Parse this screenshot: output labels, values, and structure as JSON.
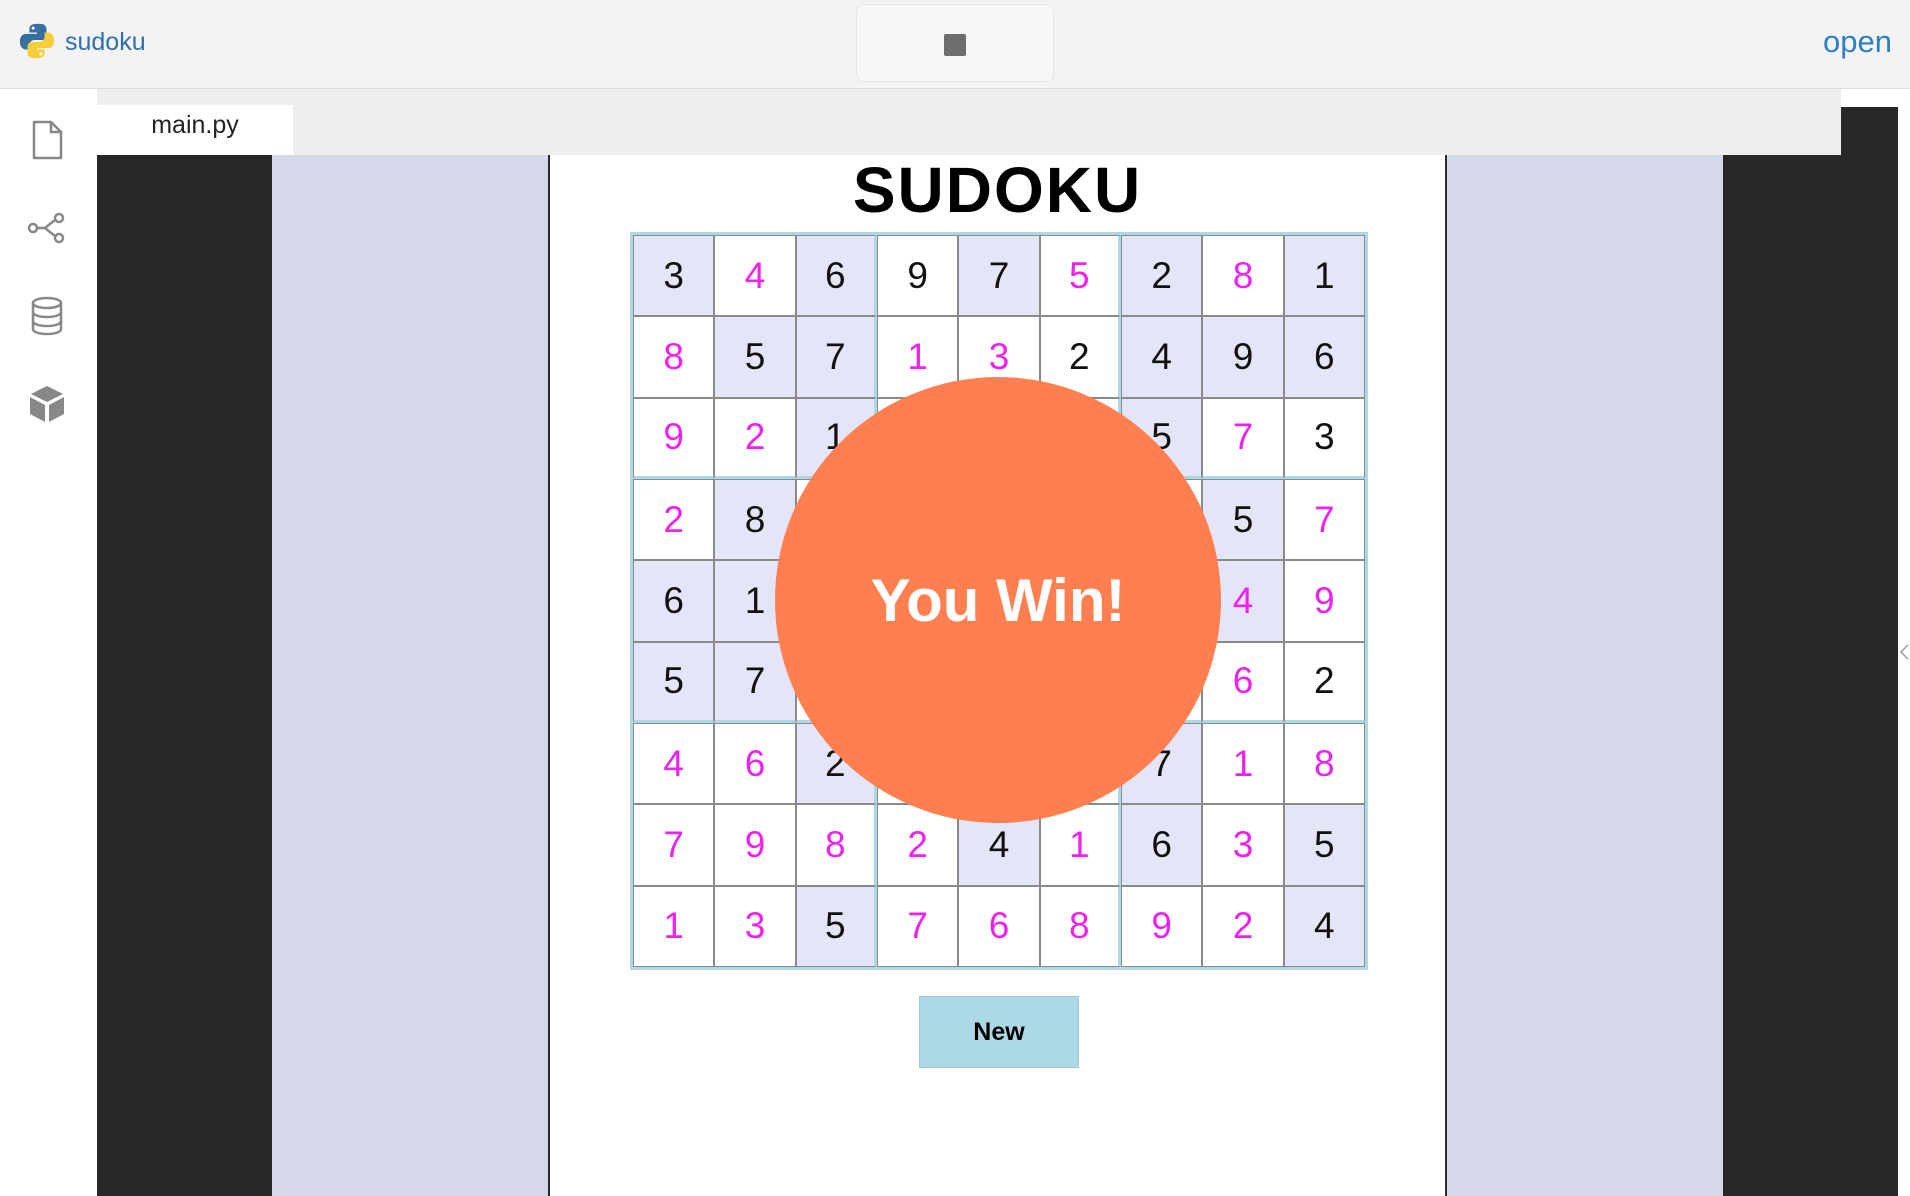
{
  "app": {
    "title": "sudoku",
    "open_label": "open"
  },
  "tabs": [
    {
      "label": "main.py"
    }
  ],
  "game": {
    "title": "SUDOKU",
    "win_message": "You Win!",
    "new_button_label": "New",
    "colors": {
      "given": "#111111",
      "entered": "#ee22ee",
      "shade": "#e5e5f8",
      "border": "#add8e6",
      "win": "#ff7f50",
      "button": "#add8e6"
    },
    "grid": [
      [
        3,
        4,
        6,
        9,
        7,
        5,
        2,
        8,
        1
      ],
      [
        8,
        5,
        7,
        1,
        3,
        2,
        4,
        9,
        6
      ],
      [
        9,
        2,
        1,
        null,
        null,
        null,
        5,
        7,
        3
      ],
      [
        2,
        8,
        null,
        null,
        null,
        null,
        null,
        5,
        7
      ],
      [
        6,
        1,
        null,
        null,
        null,
        null,
        null,
        4,
        9
      ],
      [
        5,
        7,
        null,
        null,
        null,
        null,
        null,
        6,
        2
      ],
      [
        4,
        6,
        2,
        null,
        null,
        null,
        7,
        1,
        8
      ],
      [
        7,
        9,
        8,
        2,
        4,
        1,
        6,
        3,
        5
      ],
      [
        1,
        3,
        5,
        7,
        6,
        8,
        9,
        2,
        4
      ]
    ],
    "entered": [
      [
        0,
        1,
        0,
        0,
        0,
        1,
        0,
        1,
        0
      ],
      [
        1,
        0,
        0,
        1,
        1,
        0,
        0,
        0,
        0
      ],
      [
        1,
        1,
        0,
        0,
        0,
        0,
        0,
        1,
        0
      ],
      [
        1,
        0,
        0,
        0,
        0,
        0,
        0,
        0,
        1
      ],
      [
        0,
        0,
        0,
        0,
        0,
        0,
        0,
        1,
        1
      ],
      [
        0,
        0,
        0,
        0,
        0,
        0,
        0,
        1,
        0
      ],
      [
        1,
        1,
        0,
        0,
        0,
        0,
        0,
        1,
        1
      ],
      [
        1,
        1,
        1,
        1,
        0,
        1,
        0,
        1,
        0
      ],
      [
        1,
        1,
        0,
        1,
        1,
        1,
        1,
        1,
        0
      ]
    ],
    "shaded": [
      [
        1,
        0,
        1,
        0,
        1,
        0,
        1,
        0,
        1
      ],
      [
        0,
        1,
        1,
        0,
        0,
        0,
        1,
        1,
        1
      ],
      [
        0,
        0,
        1,
        0,
        0,
        0,
        1,
        0,
        0
      ],
      [
        0,
        1,
        0,
        0,
        0,
        0,
        0,
        1,
        0
      ],
      [
        1,
        1,
        0,
        0,
        0,
        0,
        0,
        1,
        0
      ],
      [
        1,
        1,
        0,
        0,
        0,
        0,
        0,
        0,
        0
      ],
      [
        0,
        0,
        1,
        0,
        0,
        0,
        1,
        0,
        0
      ],
      [
        0,
        0,
        0,
        0,
        1,
        0,
        1,
        0,
        1
      ],
      [
        0,
        0,
        1,
        0,
        0,
        0,
        0,
        0,
        1
      ]
    ]
  }
}
